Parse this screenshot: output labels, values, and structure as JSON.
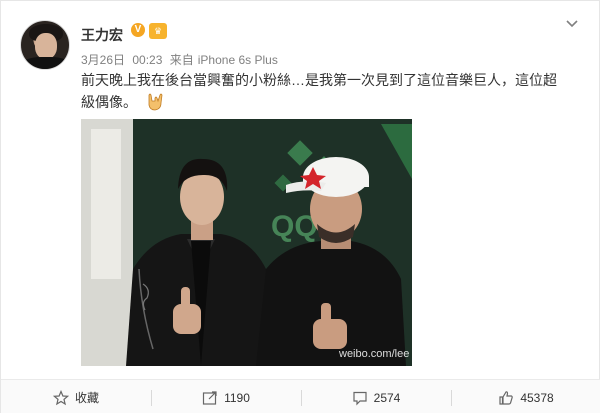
{
  "post": {
    "username": "王力宏",
    "verified_badge": "V",
    "date": "3月26日",
    "time": "00:23",
    "source_prefix": "来自",
    "source_device": "iPhone 6s Plus",
    "text": "前天晚上我在後台當興奮的小粉絲…是我第一次見到了這位音樂巨人，這位超級偶像。",
    "emoji_icon": "rock-hand-icon",
    "watermark": "weibo.com/lee"
  },
  "actions": {
    "favorite_label": "收藏",
    "share_count": "1190",
    "comment_count": "2574",
    "like_count": "45378"
  },
  "colors": {
    "verified": "#f5a623",
    "text": "#333333",
    "meta": "#808080",
    "photo_bg": "#21342a"
  }
}
